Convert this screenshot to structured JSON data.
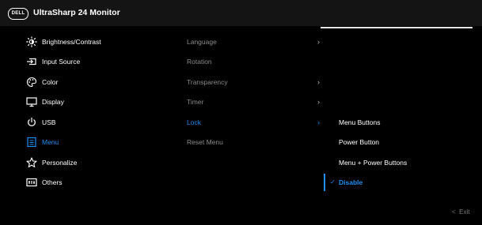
{
  "header": {
    "logo_text": "DELL",
    "title": "UltraSharp 24 Monitor"
  },
  "main_menu": [
    {
      "label": "Brightness/Contrast",
      "icon": "brightness-icon"
    },
    {
      "label": "Input Source",
      "icon": "input-source-icon"
    },
    {
      "label": "Color",
      "icon": "color-palette-icon"
    },
    {
      "label": "Display",
      "icon": "display-icon"
    },
    {
      "label": "USB",
      "icon": "usb-icon"
    },
    {
      "label": "Menu",
      "icon": "menu-icon"
    },
    {
      "label": "Personalize",
      "icon": "star-icon"
    },
    {
      "label": "Others",
      "icon": "others-icon"
    }
  ],
  "submenu": [
    {
      "label": "Language",
      "chevron": "›"
    },
    {
      "label": "Rotation",
      "chevron": ""
    },
    {
      "label": "Transparency",
      "chevron": "›"
    },
    {
      "label": "Timer",
      "chevron": "›"
    },
    {
      "label": "Lock",
      "chevron": "›"
    },
    {
      "label": "Reset Menu",
      "chevron": ""
    }
  ],
  "lock_options": [
    {
      "label": "Menu Buttons"
    },
    {
      "label": "Power Button"
    },
    {
      "label": "Menu + Power Buttons"
    },
    {
      "label": "Disable",
      "check": "✓"
    }
  ],
  "footer": {
    "exit_chevron": "<",
    "exit_label": "Exit"
  },
  "colors": {
    "accent": "#1e8ef0",
    "background": "#000000",
    "titlebar": "#141414",
    "disabled_text": "#8a8a8a"
  }
}
